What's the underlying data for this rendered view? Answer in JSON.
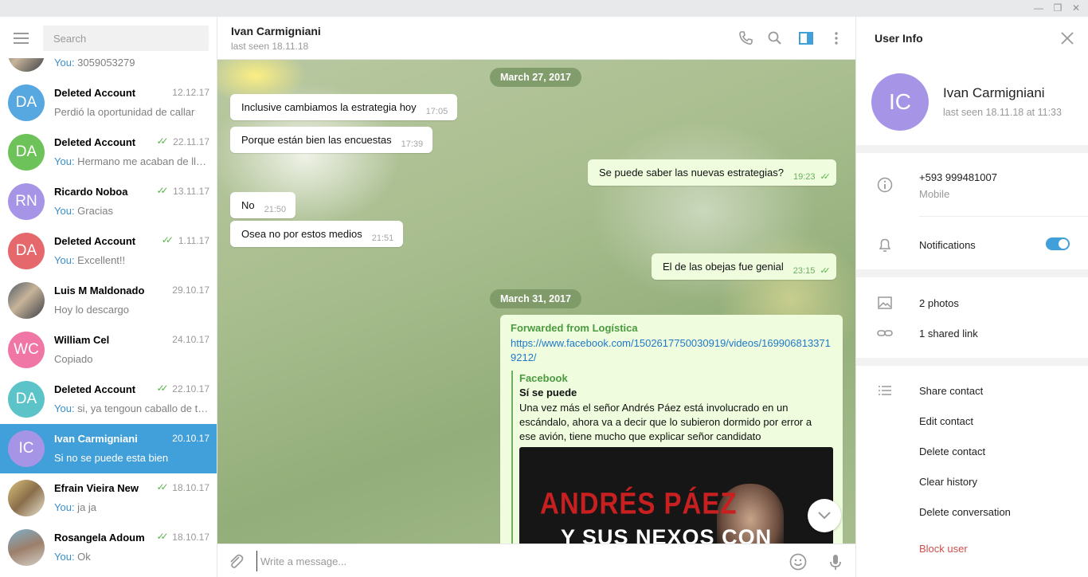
{
  "window": {
    "minimize_glyph": "—",
    "restore_glyph": "❐",
    "close_glyph": "✕"
  },
  "sidebar": {
    "search_placeholder": "Search",
    "chats": [
      {
        "initials": "",
        "avatar_color": "photo",
        "name": "",
        "date": "",
        "read": false,
        "you": "You:",
        "preview": " 3059053279"
      },
      {
        "initials": "DA",
        "avatar_color": "#57a7e0",
        "name": "Deleted Account",
        "date": "12.12.17",
        "read": false,
        "you": "",
        "preview": "Perdió la oportunidad de callar"
      },
      {
        "initials": "DA",
        "avatar_color": "#6dc35a",
        "name": "Deleted Account",
        "date": "22.11.17",
        "read": true,
        "you": "You:",
        "preview": " Hermano me acaban de llamar"
      },
      {
        "initials": "RN",
        "avatar_color": "#a695e7",
        "name": "Ricardo Noboa",
        "date": "13.11.17",
        "read": true,
        "you": "You:",
        "preview": " Gracias"
      },
      {
        "initials": "DA",
        "avatar_color": "#e5686c",
        "name": "Deleted Account",
        "date": "1.11.17",
        "read": true,
        "you": "You:",
        "preview": " Excellent!!"
      },
      {
        "initials": "",
        "avatar_color": "photo",
        "name": "Luis M Maldonado",
        "date": "29.10.17",
        "read": false,
        "you": "",
        "preview": "Hoy lo descargo"
      },
      {
        "initials": "WC",
        "avatar_color": "#ef76a5",
        "name": "William Cel",
        "date": "24.10.17",
        "read": false,
        "you": "",
        "preview": "Copiado"
      },
      {
        "initials": "DA",
        "avatar_color": "#5cc3c8",
        "name": "Deleted Account",
        "date": "22.10.17",
        "read": true,
        "you": "You:",
        "preview": " si, ya tengoun caballo de troya"
      },
      {
        "initials": "IC",
        "avatar_color": "#a695e7",
        "name": "Ivan Carmigniani",
        "date": "20.10.17",
        "read": false,
        "you": "",
        "preview": "Si no se puede esta bien",
        "active": true
      },
      {
        "initials": "",
        "avatar_color": "photo2",
        "name": "Efrain Vieira New",
        "date": "18.10.17",
        "read": true,
        "you": "You:",
        "preview": " ja ja"
      },
      {
        "initials": "",
        "avatar_color": "photo3",
        "name": "Rosangela Adoum",
        "date": "18.10.17",
        "read": true,
        "you": "You:",
        "preview": " Ok"
      }
    ]
  },
  "chat": {
    "peer_name": "Ivan Carmigniani",
    "peer_status": "last seen 18.11.18",
    "dates": [
      "March 27, 2017",
      "March 31, 2017"
    ],
    "messages": [
      {
        "text": "Inclusive cambiamos la estrategia hoy",
        "time": "17:05",
        "out": false
      },
      {
        "text": "Porque están bien las encuestas",
        "time": "17:39",
        "out": false
      },
      {
        "text": "Se puede saber las nuevas estrategias?",
        "time": "19:23",
        "out": true
      },
      {
        "text": "No",
        "time": "21:50",
        "out": false
      },
      {
        "text": "Osea no por estos medios",
        "time": "21:51",
        "out": false
      },
      {
        "text": "El de las obejas fue genial",
        "time": "23:15",
        "out": true
      }
    ],
    "forwarded": {
      "from": "Forwarded from Logística",
      "link": "https://www.facebook.com/1502617750030919/videos/1699068133719212/",
      "site": "Facebook",
      "title": "Sí se puede",
      "description": "Una vez más el señor Andrés Páez está involucrado en un escándalo, ahora va a decir que lo subieron dormido por error a ese avión, tiene mucho que explicar señor candidato",
      "image_line1": "ANDRÉS PÁEZ",
      "image_line2": "Y SUS NEXOS CON"
    },
    "composer_placeholder": "Write a message..."
  },
  "info": {
    "title": "User Info",
    "avatar_initials": "IC",
    "name": "Ivan Carmigniani",
    "last_seen": "last seen 18.11.18 at 11:33",
    "phone": "+593 999481007",
    "phone_label": "Mobile",
    "notifications_label": "Notifications",
    "notifications_on": true,
    "photos": "2 photos",
    "shared_links": "1 shared link",
    "actions": [
      "Share contact",
      "Edit contact",
      "Delete contact",
      "Clear history",
      "Delete conversation"
    ],
    "block": "Block user"
  },
  "colors": {
    "accent": "#419fd9",
    "check": "#5ab64a",
    "danger": "#d14e4e",
    "out_bubble": "#effdde"
  }
}
